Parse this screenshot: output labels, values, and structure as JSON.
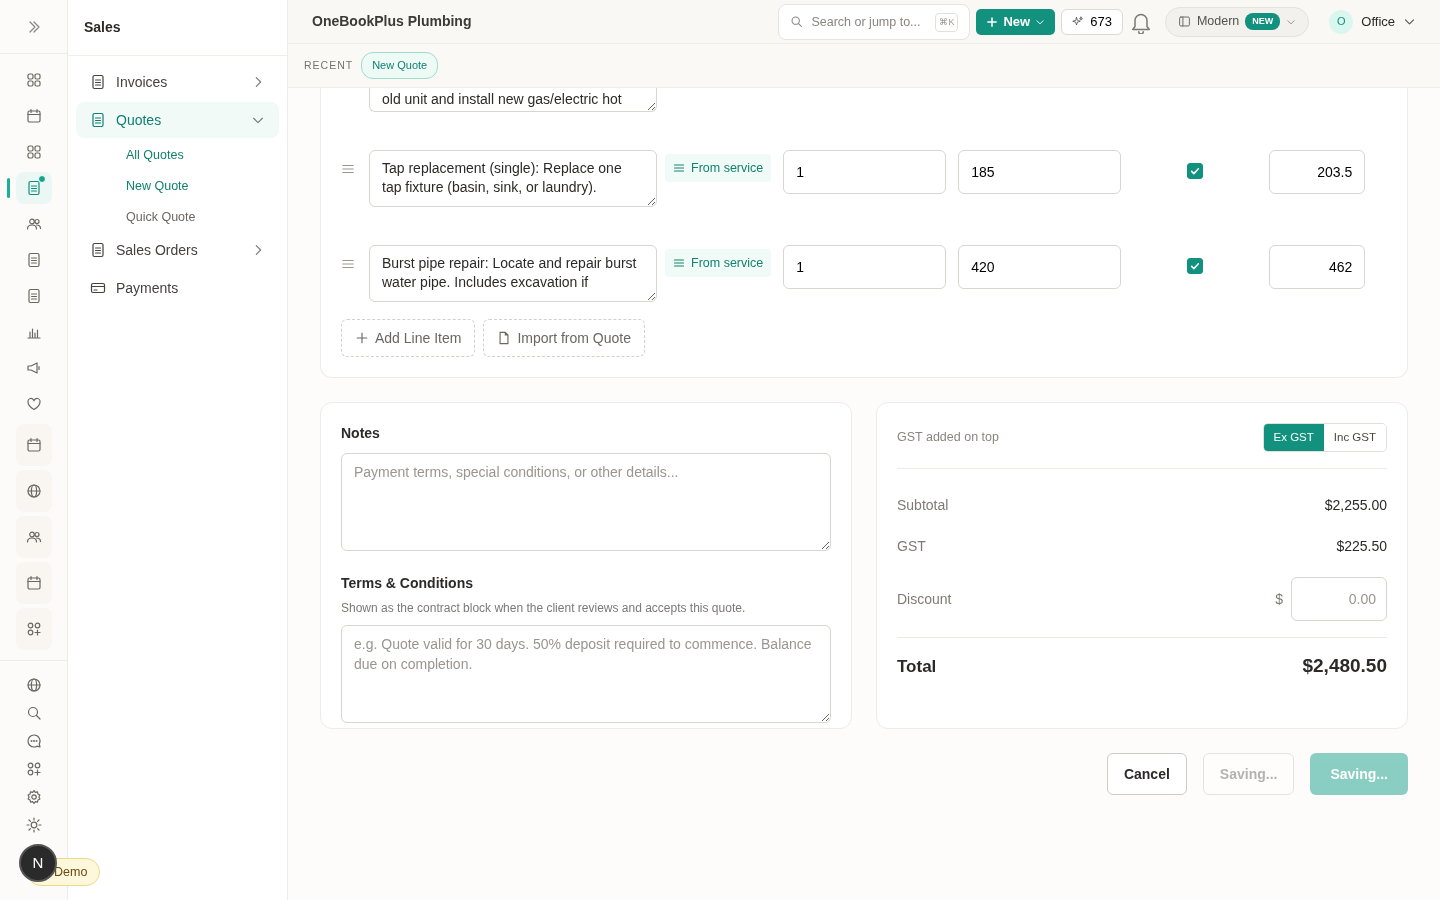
{
  "rail": {
    "items": [
      {
        "kind": "grid",
        "selected": false
      },
      {
        "kind": "calendar",
        "selected": false
      },
      {
        "kind": "grid",
        "selected": false
      },
      {
        "kind": "doc",
        "selected": true,
        "dot": true
      },
      {
        "kind": "people",
        "selected": false
      },
      {
        "kind": "doc",
        "selected": false
      },
      {
        "kind": "doc",
        "selected": false
      },
      {
        "kind": "chart",
        "selected": false
      },
      {
        "kind": "megaphone",
        "selected": false
      },
      {
        "kind": "heart",
        "selected": false
      },
      {
        "kind": "calendar",
        "selected": false
      },
      {
        "kind": "globe",
        "selected": false
      },
      {
        "kind": "people",
        "selected": false
      },
      {
        "kind": "calendar",
        "selected": false
      },
      {
        "kind": "apps",
        "selected": false
      }
    ],
    "bottom": [
      {
        "kind": "globe"
      },
      {
        "kind": "search"
      },
      {
        "kind": "chat"
      },
      {
        "kind": "apps"
      },
      {
        "kind": "gear"
      },
      {
        "kind": "sun"
      }
    ],
    "avatar": "N",
    "demo": "Demo"
  },
  "sidebar": {
    "title": "Sales",
    "items": [
      {
        "label": "Invoices",
        "selected": false,
        "expanded": false
      },
      {
        "label": "Quotes",
        "selected": true,
        "expanded": true,
        "children": [
          {
            "label": "All Quotes",
            "active": true
          },
          {
            "label": "New Quote",
            "active": true
          },
          {
            "label": "Quick Quote",
            "active": false
          }
        ]
      },
      {
        "label": "Sales Orders",
        "selected": false,
        "expanded": false
      },
      {
        "label": "Payments",
        "selected": false
      }
    ]
  },
  "header": {
    "title": "OneBookPlus Plumbing",
    "search": {
      "placeholder": "Search or jump to...",
      "shortcut": "⌘K"
    },
    "new_button": "New",
    "credits": "673",
    "view": {
      "label": "Modern",
      "badge": "NEW"
    },
    "user": {
      "initial": "O",
      "name": "Office"
    }
  },
  "recent": {
    "label": "RECENT",
    "chips": [
      "New Quote"
    ]
  },
  "line_items": [
    {
      "kind": "cut",
      "description": "old unit and install new gas/electric hot"
    },
    {
      "kind": "full",
      "description": "Tap replacement (single): Replace one tap fixture (basin, sink, or laundry).",
      "source": "From service",
      "quantity": "1",
      "price": "185",
      "taxed": true,
      "total": "203.5"
    },
    {
      "kind": "full",
      "description": "Burst pipe repair: Locate and repair burst water pipe. Includes excavation if",
      "source": "From service",
      "quantity": "1",
      "price": "420",
      "taxed": true,
      "total": "462"
    }
  ],
  "line_actions": [
    {
      "kind": "plus",
      "label": "Add Line Item"
    },
    {
      "kind": "file",
      "label": "Import from Quote"
    }
  ],
  "notes": {
    "label": "Notes",
    "placeholder": "Payment terms, special conditions, or other details..."
  },
  "terms": {
    "label": "Terms & Conditions",
    "hint": "Shown as the contract block when the client reviews and accepts this quote.",
    "placeholder": "e.g. Quote valid for 30 days. 50% deposit required to commence. Balance due on completion."
  },
  "totals": {
    "gst_note": "GST added on top",
    "gst_modes": [
      {
        "label": "Ex GST",
        "selected": true
      },
      {
        "label": "Inc GST",
        "selected": false
      }
    ],
    "subtotal": {
      "label": "Subtotal",
      "value": "$2,255.00"
    },
    "gst": {
      "label": "GST",
      "value": "$225.50"
    },
    "discount": {
      "label": "Discount",
      "prefix": "$",
      "placeholder": "0.00"
    },
    "total": {
      "label": "Total",
      "value": "$2,480.50"
    }
  },
  "actions": [
    {
      "kind": "cancel",
      "label": "Cancel",
      "disabled": false
    },
    {
      "kind": "outline",
      "label": "Saving...",
      "disabled": true
    },
    {
      "kind": "primary",
      "label": "Saving...",
      "disabled": true
    }
  ]
}
